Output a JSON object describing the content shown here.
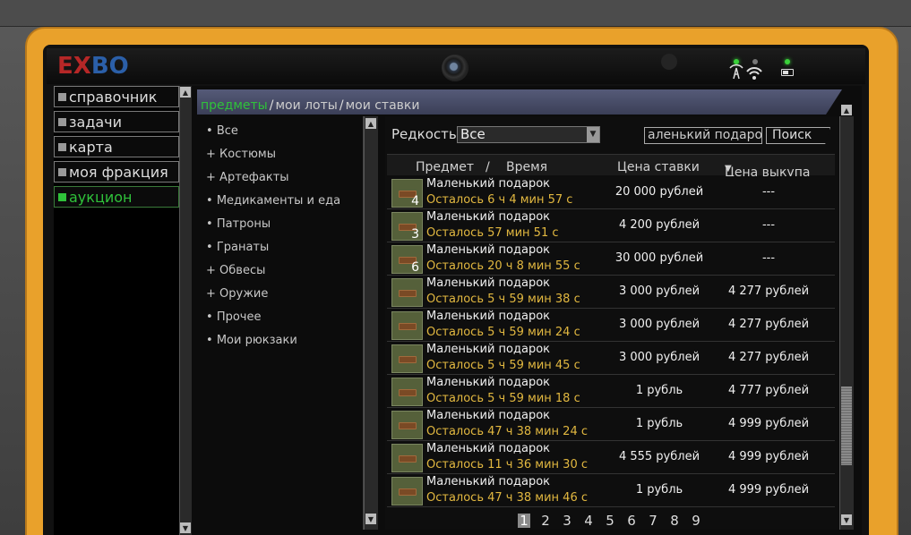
{
  "logo": {
    "part1": "EX",
    "part2": "BO"
  },
  "nav": {
    "items": [
      {
        "label": "справочник",
        "active": false
      },
      {
        "label": "задачи",
        "active": false
      },
      {
        "label": "карта",
        "active": false
      },
      {
        "label": "моя фракция",
        "active": false
      },
      {
        "label": "аукцион",
        "active": true
      }
    ]
  },
  "tabs": {
    "items": [
      "предметы",
      "мои лоты",
      "мои ставки"
    ],
    "active": "предметы",
    "separator": "/"
  },
  "categories": [
    {
      "prefix": "•",
      "label": "Все"
    },
    {
      "prefix": "+",
      "label": "Костюмы"
    },
    {
      "prefix": "+",
      "label": "Артефакты"
    },
    {
      "prefix": "•",
      "label": "Медикаменты и еда"
    },
    {
      "prefix": "•",
      "label": "Патроны"
    },
    {
      "prefix": "•",
      "label": "Гранаты"
    },
    {
      "prefix": "+",
      "label": "Обвесы"
    },
    {
      "prefix": "+",
      "label": "Оружие"
    },
    {
      "prefix": "•",
      "label": "Прочее"
    },
    {
      "prefix": "•",
      "label": "Мои рюкзаки"
    }
  ],
  "filter": {
    "rarity_label": "Редкость",
    "rarity_value": "Все",
    "search_value": "аленький подарок",
    "search_button": "Поиск"
  },
  "table": {
    "col_item": "Предмет",
    "col_sep": "/",
    "col_time": "Время",
    "col_bid": "Цена ставки",
    "col_buyout": "Цена выкупа",
    "sort_indicator": "▼",
    "rows": [
      {
        "qty": "4",
        "name": "Маленький подарок",
        "time": "Осталось 6 ч 4 мин 57 с",
        "bid": "20 000 рублей",
        "buyout": "---"
      },
      {
        "qty": "3",
        "name": "Маленький подарок",
        "time": "Осталось 57 мин 51 с",
        "bid": "4 200 рублей",
        "buyout": "---"
      },
      {
        "qty": "6",
        "name": "Маленький подарок",
        "time": "Осталось 20 ч 8 мин 55 с",
        "bid": "30 000 рублей",
        "buyout": "---"
      },
      {
        "qty": "",
        "name": "Маленький подарок",
        "time": "Осталось 5 ч 59 мин 38 с",
        "bid": "3 000 рублей",
        "buyout": "4 277 рублей"
      },
      {
        "qty": "",
        "name": "Маленький подарок",
        "time": "Осталось 5 ч 59 мин 24 с",
        "bid": "3 000 рублей",
        "buyout": "4 277 рублей"
      },
      {
        "qty": "",
        "name": "Маленький подарок",
        "time": "Осталось 5 ч 59 мин 45 с",
        "bid": "3 000 рублей",
        "buyout": "4 277 рублей"
      },
      {
        "qty": "",
        "name": "Маленький подарок",
        "time": "Осталось 5 ч 59 мин 18 с",
        "bid": "1 рубль",
        "buyout": "4 777 рублей"
      },
      {
        "qty": "",
        "name": "Маленький подарок",
        "time": "Осталось 47 ч 38 мин 24 с",
        "bid": "1 рубль",
        "buyout": "4 999 рублей"
      },
      {
        "qty": "",
        "name": "Маленький подарок",
        "time": "Осталось 11 ч 36 мин 30 с",
        "bid": "4 555 рублей",
        "buyout": "4 999 рублей"
      },
      {
        "qty": "",
        "name": "Маленький подарок",
        "time": "Осталось 47 ч 38 мин 46 с",
        "bid": "1 рубль",
        "buyout": "4 999 рублей"
      }
    ]
  },
  "pagination": {
    "pages": [
      "1",
      "2",
      "3",
      "4",
      "5",
      "6",
      "7",
      "8",
      "9"
    ],
    "current": "1"
  },
  "colors": {
    "frame_orange": "#e9a12b",
    "active_green": "#2fc23a",
    "time_yellow": "#e2b840",
    "tabbar": "#4a4e6a"
  }
}
